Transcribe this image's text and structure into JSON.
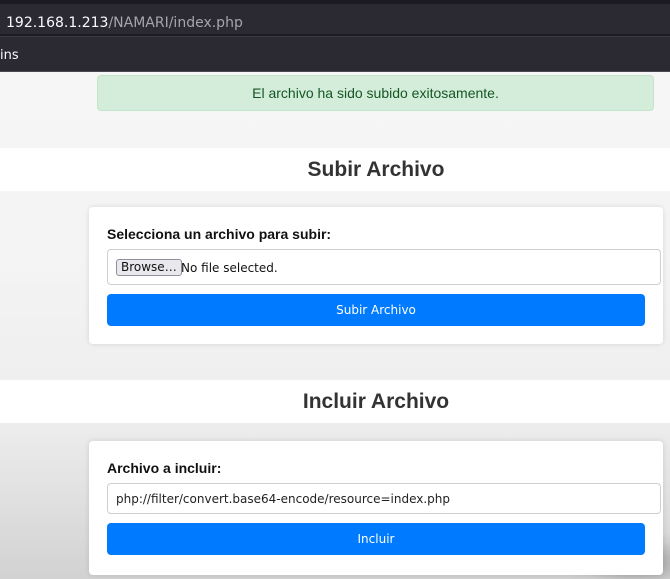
{
  "browser": {
    "url_host": "192.168.1.213",
    "url_path": "/NAMARI/index.php",
    "bookmarks_fragment": "ins"
  },
  "alert": {
    "message": "El archivo ha sido subido exitosamente."
  },
  "upload_section": {
    "title": "Subir Archivo",
    "label": "Selecciona un archivo para subir:",
    "browse_label": "Browse…",
    "file_status": "No file selected.",
    "submit_label": "Subir Archivo"
  },
  "include_section": {
    "title": "Incluir Archivo",
    "label": "Archivo a incluir:",
    "input_value": "php://filter/convert.base64-encode/resource=index.php",
    "submit_label": "Incluir"
  },
  "colors": {
    "primary": "#007bff",
    "success_bg": "#d4edda",
    "success_text": "#155724"
  }
}
